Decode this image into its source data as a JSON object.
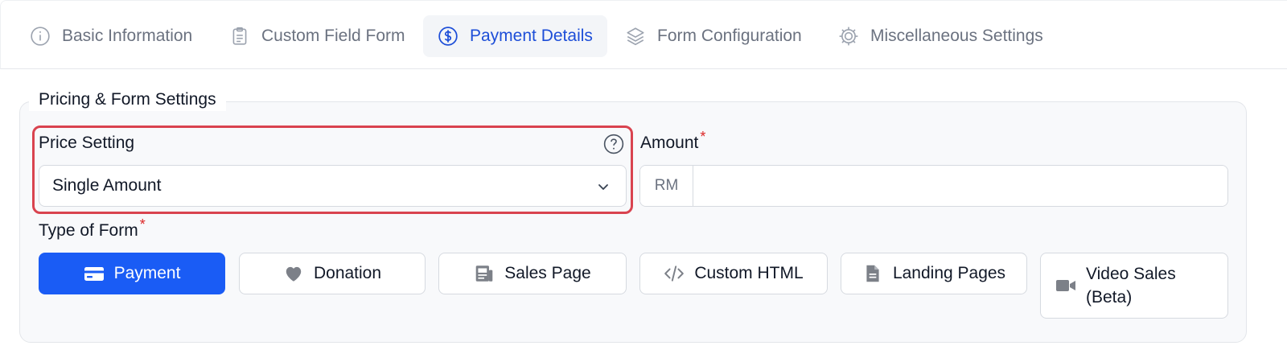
{
  "tabs": [
    {
      "label": "Basic Information",
      "icon": "info-circle-icon",
      "active": false
    },
    {
      "label": "Custom Field Form",
      "icon": "clipboard-icon",
      "active": false
    },
    {
      "label": "Payment Details",
      "icon": "dollar-circle-icon",
      "active": true
    },
    {
      "label": "Form Configuration",
      "icon": "layers-icon",
      "active": false
    },
    {
      "label": "Miscellaneous Settings",
      "icon": "gear-icon",
      "active": false
    }
  ],
  "section": {
    "legend": "Pricing & Form Settings"
  },
  "price_setting": {
    "label": "Price Setting",
    "value": "Single Amount",
    "help_icon": "question-circle-icon"
  },
  "amount": {
    "label": "Amount",
    "required_mark": "*",
    "prefix": "RM",
    "value": ""
  },
  "type_of_form": {
    "label": "Type of Form",
    "required_mark": "*",
    "options": [
      {
        "label": "Payment",
        "icon": "credit-card-icon",
        "active": true
      },
      {
        "label": "Donation",
        "icon": "heart-icon",
        "active": false
      },
      {
        "label": "Sales Page",
        "icon": "newspaper-icon",
        "active": false
      },
      {
        "label": "Custom HTML",
        "icon": "code-icon",
        "active": false
      },
      {
        "label": "Landing Pages",
        "icon": "document-icon",
        "active": false
      },
      {
        "label": "Video Sales (Beta)",
        "icon": "video-camera-icon",
        "active": false
      }
    ]
  },
  "colors": {
    "accent": "#1a5cf5",
    "active_tab_text": "#1d4ed8",
    "highlight_border": "#d9434f",
    "required": "#dc2626"
  }
}
